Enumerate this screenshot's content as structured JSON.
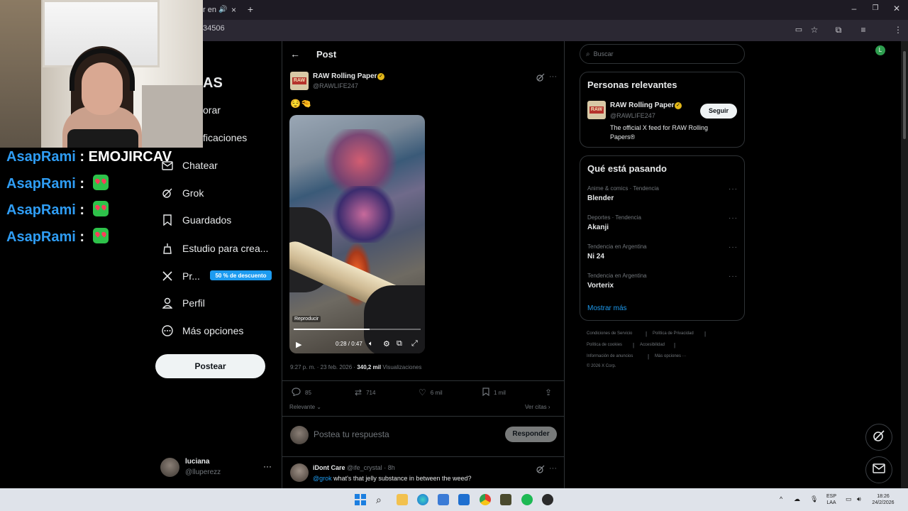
{
  "browser": {
    "tab_fragment": "r en",
    "url_fragment": "34506"
  },
  "chat": [
    {
      "user": "AsapRami",
      "sep": ":",
      "msg": "EMOJIRCAV",
      "emote": false
    },
    {
      "user": "AsapRami",
      "sep": ":",
      "msg": "",
      "emote": true
    },
    {
      "user": "AsapRami",
      "sep": ":",
      "msg": "",
      "emote": true
    },
    {
      "user": "AsapRami",
      "sep": ":",
      "msg": "",
      "emote": true
    }
  ],
  "nav": {
    "logo_fragment": "AS",
    "explore_fragment": "orar",
    "notifications_fragment": "ficaciones",
    "items": [
      {
        "label": "Chatear",
        "icon": "mail-icon"
      },
      {
        "label": "Grok",
        "icon": "grok-icon"
      },
      {
        "label": "Guardados",
        "icon": "bookmark-icon"
      },
      {
        "label": "Estudio para crea...",
        "icon": "creator-studio-icon"
      },
      {
        "label": "Pr...",
        "icon": "x-logo-icon"
      },
      {
        "label": "Perfil",
        "icon": "person-icon"
      },
      {
        "label": "Más opciones",
        "icon": "more-circle-icon"
      }
    ],
    "premium_badge": "50 % de descuento",
    "post_button": "Postear",
    "account": {
      "name": "luciana",
      "handle": "@lluperezz"
    }
  },
  "post": {
    "header": "Post",
    "author": "RAW Rolling Paper",
    "handle": "@RAWLIFE247",
    "emoji_text": "😌🤏",
    "video": {
      "label": "Reproducir",
      "time": "0:28 / 0:47",
      "progress": 0.596
    },
    "timestamp": "9:27 p. m. · 23 feb. 2026 ·",
    "views_count": "340,2 mil",
    "views_label": "Visualizaciones",
    "replies": "85",
    "reposts": "714",
    "likes": "6 mil",
    "bookmarks": "1 mil",
    "sort_label": "Relevante",
    "quotes_label": "Ver citas",
    "reply_placeholder": "Postea tu respuesta",
    "reply_button": "Responder"
  },
  "reply": {
    "name": "iDont Care",
    "handle": "@ife_crystal",
    "time": "· 8h",
    "mention": "@grok",
    "text": " what's that jelly substance in between the weed?"
  },
  "sidebar": {
    "search_placeholder": "Buscar",
    "relevant_title": "Personas relevantes",
    "relevant": {
      "name": "RAW Rolling Paper",
      "handle": "@RAWLIFE247",
      "bio": "The official X feed for RAW Rolling Papers®",
      "follow": "Seguir"
    },
    "trends_title": "Qué está pasando",
    "trends": [
      {
        "meta": "Anime & comics · Tendencia",
        "name": "Blender"
      },
      {
        "meta": "Deportes · Tendencia",
        "name": "Akanji"
      },
      {
        "meta": "Tendencia en Argentina",
        "name": "Ni 24"
      },
      {
        "meta": "Tendencia en Argentina",
        "name": "Vorterix"
      }
    ],
    "show_more": "Mostrar más",
    "footer": {
      "terms": "Condiciones de Servicio",
      "privacy": "Política de Privacidad",
      "cookies": "Política de cookies",
      "accessibility": "Accesibilidad",
      "ads": "Información de anuncios",
      "more": "Más opciones ···",
      "copyright": "© 2026 X Corp."
    }
  },
  "taskbar": {
    "lang1": "ESP",
    "lang2": "LAA",
    "time": "18:26",
    "date": "24/2/2026"
  },
  "colors": {
    "accent": "#1d9bf0",
    "chat_user": "#2f9df4",
    "verified": "#e2b719"
  }
}
